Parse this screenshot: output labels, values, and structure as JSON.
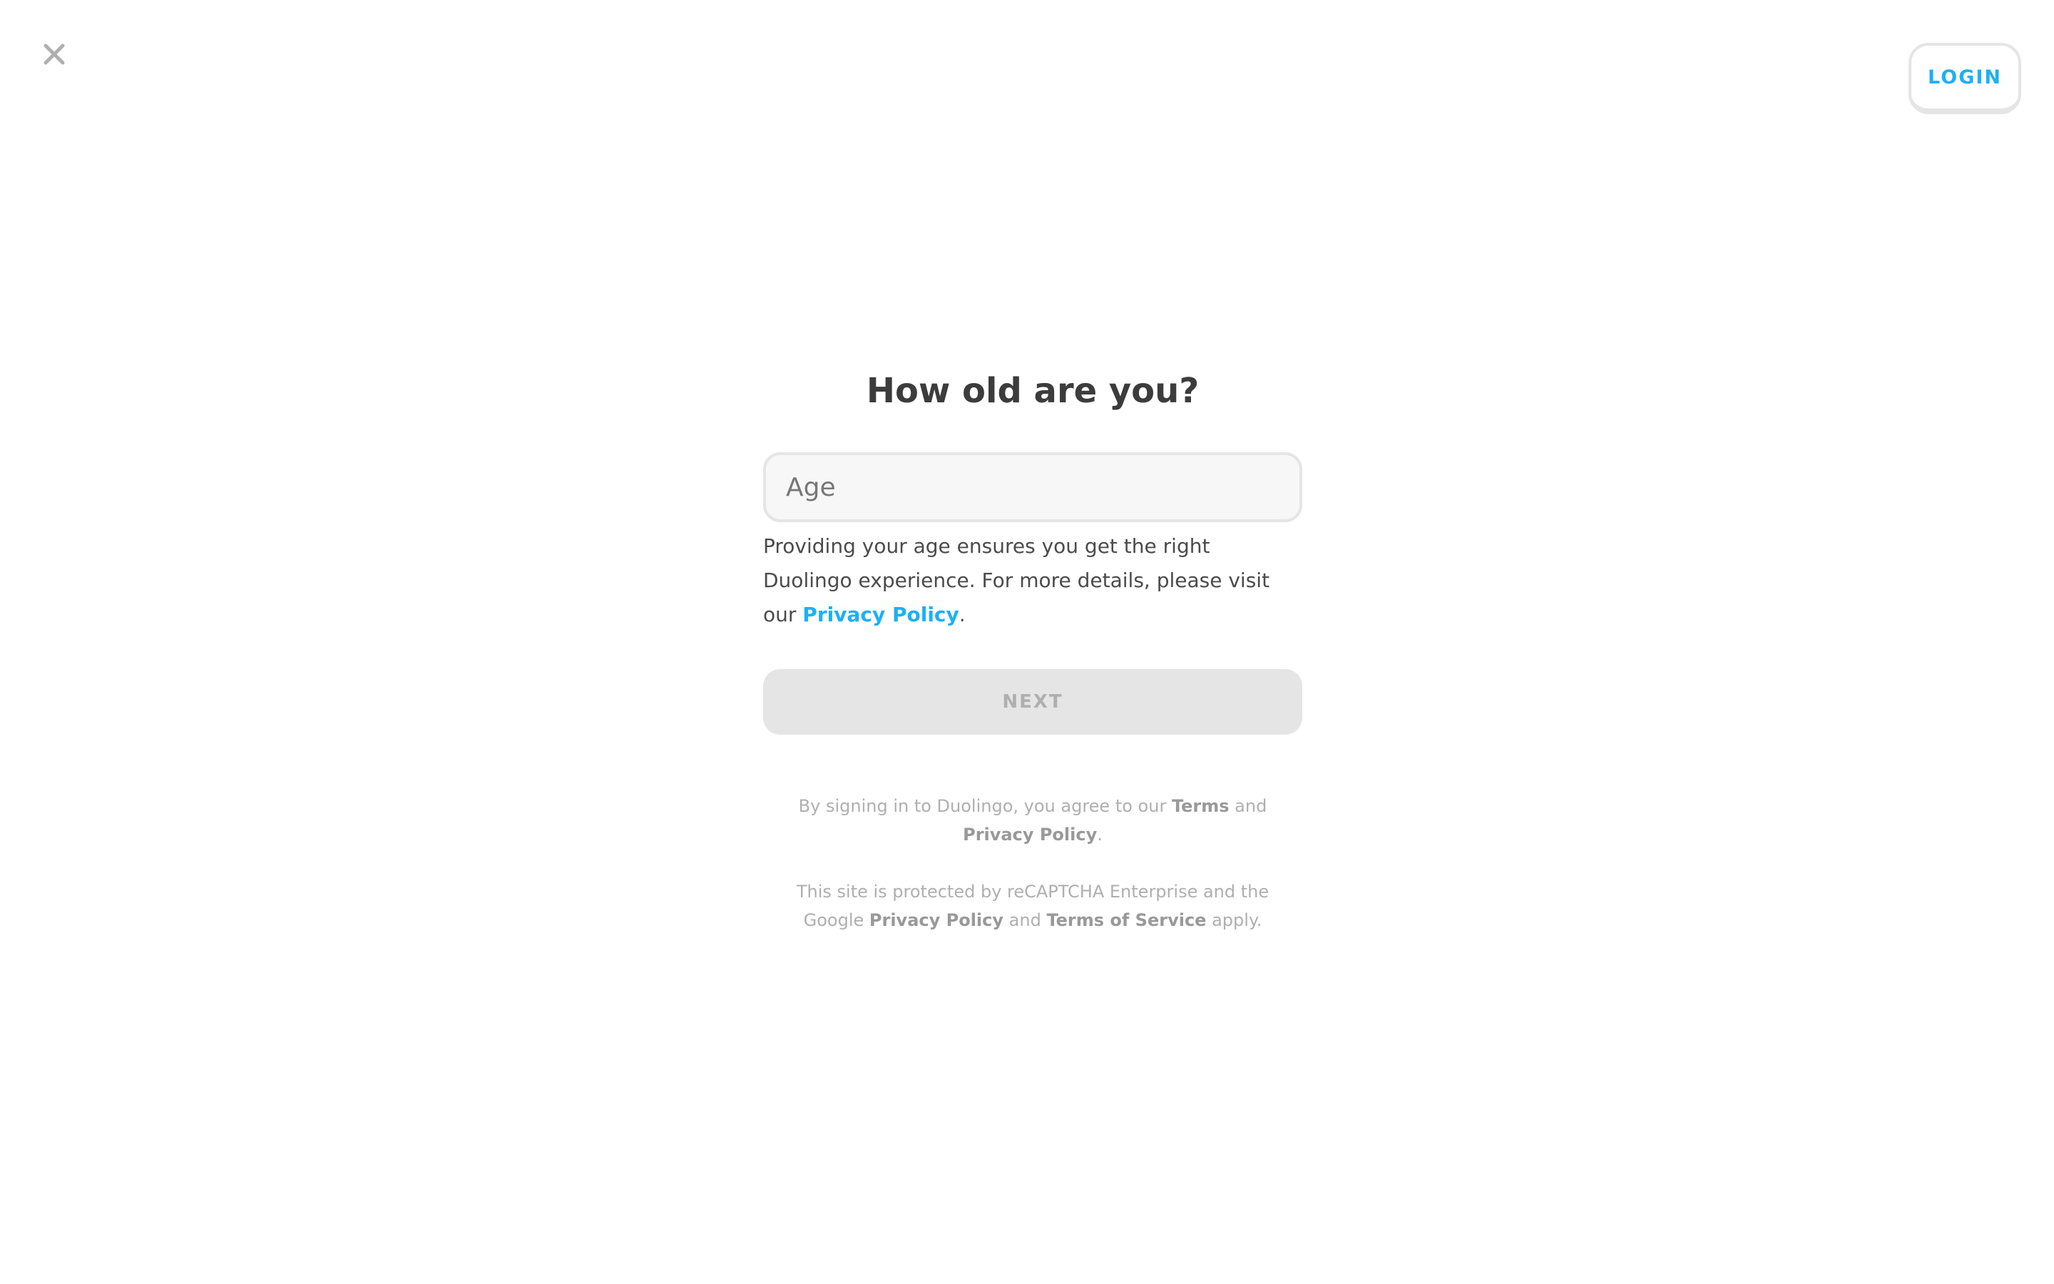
{
  "header": {
    "close_icon": "close-icon",
    "login_label": "LOGIN"
  },
  "main": {
    "title": "How old are you?",
    "age_placeholder": "Age",
    "age_value": "",
    "helper_text": "Providing your age ensures you get the right Duolingo experience. For more details, please visit our ",
    "helper_link": "Privacy Policy",
    "helper_end": ".",
    "next_label": "NEXT"
  },
  "legal": {
    "signin_text": "By signing in to Duolingo, you agree to our ",
    "terms_link": "Terms",
    "and1": " and ",
    "privacy_link": "Privacy Policy",
    "end1": ".",
    "recaptcha_text": "This site is protected by reCAPTCHA Enterprise and the Google ",
    "google_privacy_link": "Privacy Policy",
    "and2": " and ",
    "google_terms_link": "Terms of Service",
    "end2": " apply."
  },
  "colors": {
    "accent": "#1cb0f6",
    "disabled_bg": "#e5e5e5",
    "disabled_text": "#afafaf",
    "title": "#3c3c3c"
  }
}
